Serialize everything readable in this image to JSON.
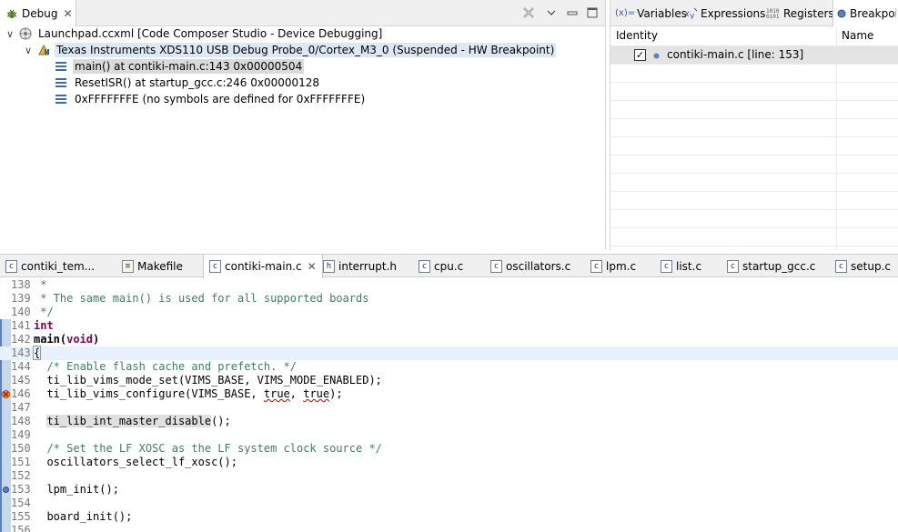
{
  "debug": {
    "tab_label": "Debug",
    "tree": [
      {
        "label": "Launchpad.ccxml [Code Composer Studio - Device Debugging]",
        "level": 0,
        "expanded": true
      },
      {
        "label": "Texas Instruments XDS110 USB Debug Probe_0/Cortex_M3_0 (Suspended - HW Breakpoint)",
        "level": 1,
        "expanded": true,
        "selected": true
      },
      {
        "label": "main() at contiki-main.c:143 0x00000504",
        "level": 2,
        "frame_selected": true
      },
      {
        "label": "ResetISR() at startup_gcc.c:246 0x00000128",
        "level": 2
      },
      {
        "label": "0xFFFFFFFE  (no symbols are defined for 0xFFFFFFFE)",
        "level": 2
      }
    ]
  },
  "side_panel": {
    "tabs": [
      {
        "label": "Variables",
        "prefix": "(x)="
      },
      {
        "label": "Expressions",
        "prefix": ""
      },
      {
        "label": "Registers",
        "prefix": ""
      },
      {
        "label": "Breakpoi",
        "prefix": ""
      }
    ],
    "columns": [
      "Identity",
      "Name"
    ],
    "breakpoints": [
      {
        "label": "contiki-main.c [line: 153]",
        "checked": true
      }
    ]
  },
  "editor": {
    "tabs": [
      {
        "label": "contiki_tem...",
        "icon": "c"
      },
      {
        "label": "Makefile",
        "icon": "mk"
      },
      {
        "label": "contiki-main.c",
        "icon": "c",
        "active": true,
        "closeable": true
      },
      {
        "label": "interrupt.h",
        "icon": "h"
      },
      {
        "label": "cpu.c",
        "icon": "c"
      },
      {
        "label": "oscillators.c",
        "icon": "c"
      },
      {
        "label": "lpm.c",
        "icon": "c"
      },
      {
        "label": "list.c",
        "icon": "c"
      },
      {
        "label": "startup_gcc.c",
        "icon": "c"
      },
      {
        "label": "setup.c",
        "icon": "c"
      }
    ],
    "lines": [
      {
        "n": "138",
        "t": " *",
        "k": "cm"
      },
      {
        "n": "139",
        "t": " * The same main() is used for all supported boards",
        "k": "cm"
      },
      {
        "n": "140",
        "t": " */",
        "k": "cm"
      },
      {
        "n": "141",
        "t": "int",
        "k": "kw"
      },
      {
        "n": "142",
        "t": "main(void)",
        "k": "main"
      },
      {
        "n": "143",
        "t": "{",
        "k": "brace"
      },
      {
        "n": "144",
        "t": "  /* Enable flash cache and prefetch. */",
        "k": "cm"
      },
      {
        "n": "145",
        "t": "  ti_lib_vims_mode_set(VIMS_BASE, VIMS_MODE_ENABLED);",
        "k": "plain"
      },
      {
        "n": "146",
        "t": "  ti_lib_vims_configure(VIMS_BASE, true, true);",
        "k": "squig"
      },
      {
        "n": "147",
        "t": "",
        "k": "plain"
      },
      {
        "n": "148",
        "t": "  ti_lib_int_master_disable();",
        "k": "hl"
      },
      {
        "n": "149",
        "t": "",
        "k": "plain"
      },
      {
        "n": "150",
        "t": "  /* Set the LF XOSC as the LF system clock source */",
        "k": "cm"
      },
      {
        "n": "151",
        "t": "  oscillators_select_lf_xosc();",
        "k": "plain"
      },
      {
        "n": "152",
        "t": "",
        "k": "plain"
      },
      {
        "n": "153",
        "t": "  lpm_init();",
        "k": "plain"
      },
      {
        "n": "154",
        "t": "",
        "k": "plain"
      },
      {
        "n": "155",
        "t": "  board_init();",
        "k": "plain"
      },
      {
        "n": "156",
        "t": "",
        "k": "plain"
      }
    ],
    "current_line": "143",
    "breakpoint_line": "153",
    "warning_line": "146"
  }
}
